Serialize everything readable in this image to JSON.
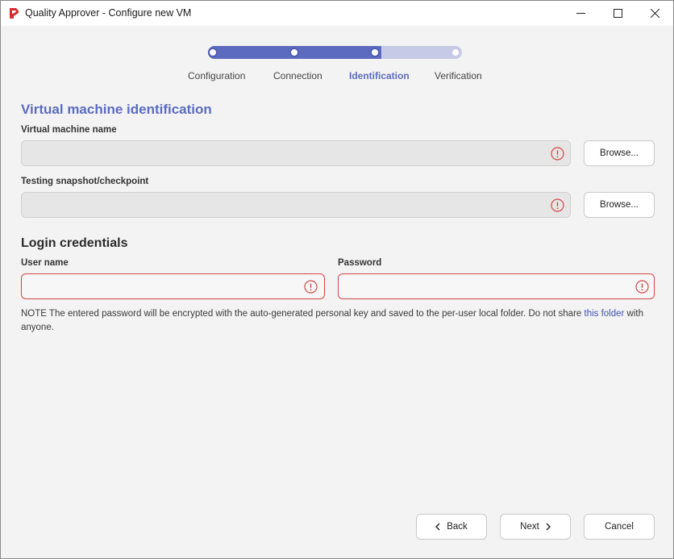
{
  "window": {
    "title": "Quality Approver - Configure new VM",
    "app_icon": "quality-approver-logo-icon",
    "controls": [
      "minimize-icon",
      "maximize-icon",
      "close-icon"
    ]
  },
  "stepper": {
    "steps": [
      {
        "label": "Configuration",
        "state": "done"
      },
      {
        "label": "Connection",
        "state": "done"
      },
      {
        "label": "Identification",
        "state": "active"
      },
      {
        "label": "Verification",
        "state": "pending"
      }
    ],
    "progress": 0.667,
    "colors": {
      "accent": "#5c6bc0",
      "track": "#c7cae6"
    }
  },
  "vm_section": {
    "heading": "Virtual machine identification",
    "vm_name": {
      "label": "Virtual machine name",
      "value": "",
      "browse_label": "Browse..."
    },
    "snapshot": {
      "label": "Testing snapshot/checkpoint",
      "value": "",
      "browse_label": "Browse..."
    }
  },
  "login_section": {
    "heading": "Login credentials",
    "username": {
      "label": "User name",
      "value": ""
    },
    "password": {
      "label": "Password",
      "value": ""
    },
    "note_text": "NOTE The entered password will be encrypted with the auto-generated personal key and saved to the per-user local folder. Do not share ",
    "note_link": "this folder",
    "note_tail": " with anyone."
  },
  "footer": {
    "back_label": "Back",
    "next_label": "Next",
    "cancel_label": "Cancel"
  },
  "colors": {
    "error": "#d64545",
    "link": "#3f51b5"
  }
}
